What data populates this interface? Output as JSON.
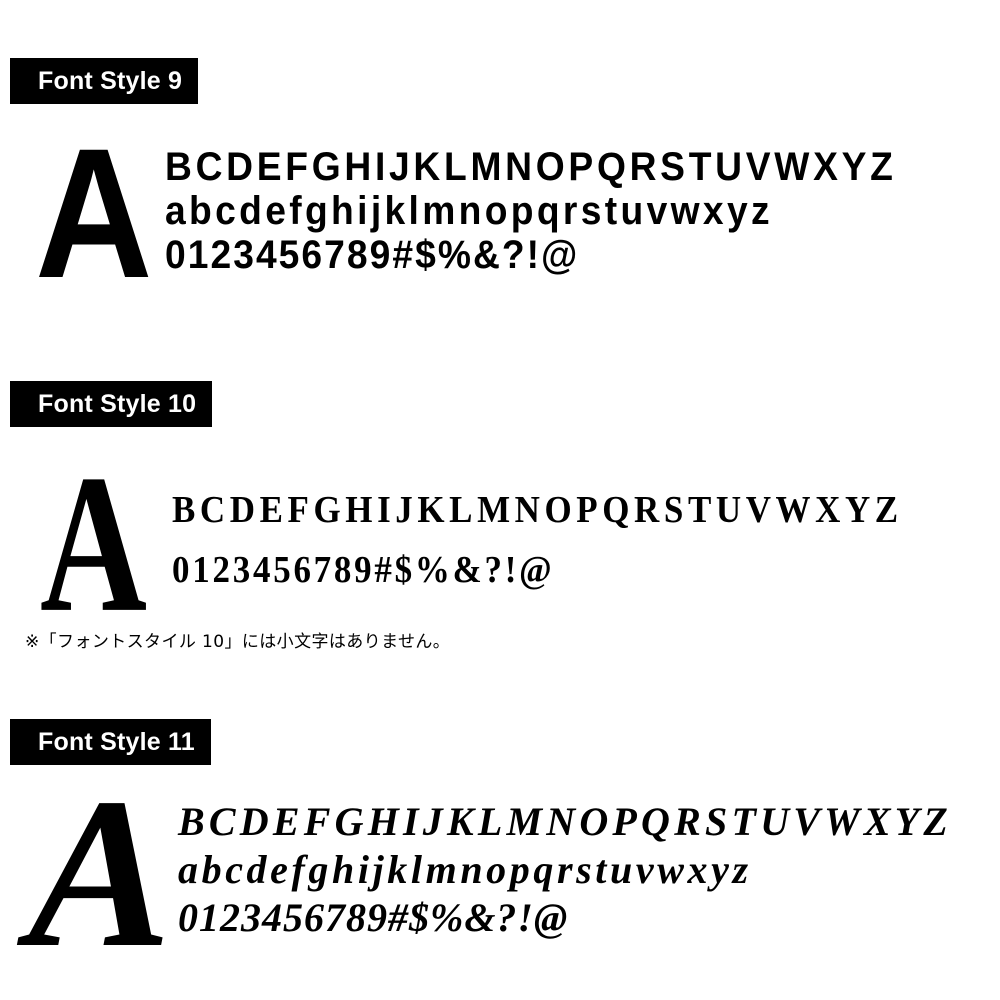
{
  "page": {
    "background_color": "#ffffff",
    "text_color": "#000000",
    "label_bg_color": "#000000",
    "label_text_color": "#ffffff"
  },
  "sections": [
    {
      "label": "Font Style 9",
      "sample_letter": "A",
      "uppercase": "BCDEFGHIJKLMNOPQRSTUVWXYZ",
      "lowercase": "abcdefghijklmnopqrstuvwxyz",
      "digits_symbols": "0123456789#$%&?!@"
    },
    {
      "label": "Font Style 10",
      "sample_letter": "A",
      "uppercase": "BCDEFGHIJKLMNOPQRSTUVWXYZ",
      "lowercase": "",
      "digits_symbols": "0123456789#$%&?!@"
    },
    {
      "label": "Font Style 11",
      "sample_letter": "A",
      "uppercase": "BCDEFGHIJKLMNOPQRSTUVWXYZ",
      "lowercase": "abcdefghijklmnopqrstuvwxyz",
      "digits_symbols": "0123456789#$%&?!@"
    }
  ],
  "footnote": "※「フォントスタイル 10」には小文字はありません。"
}
